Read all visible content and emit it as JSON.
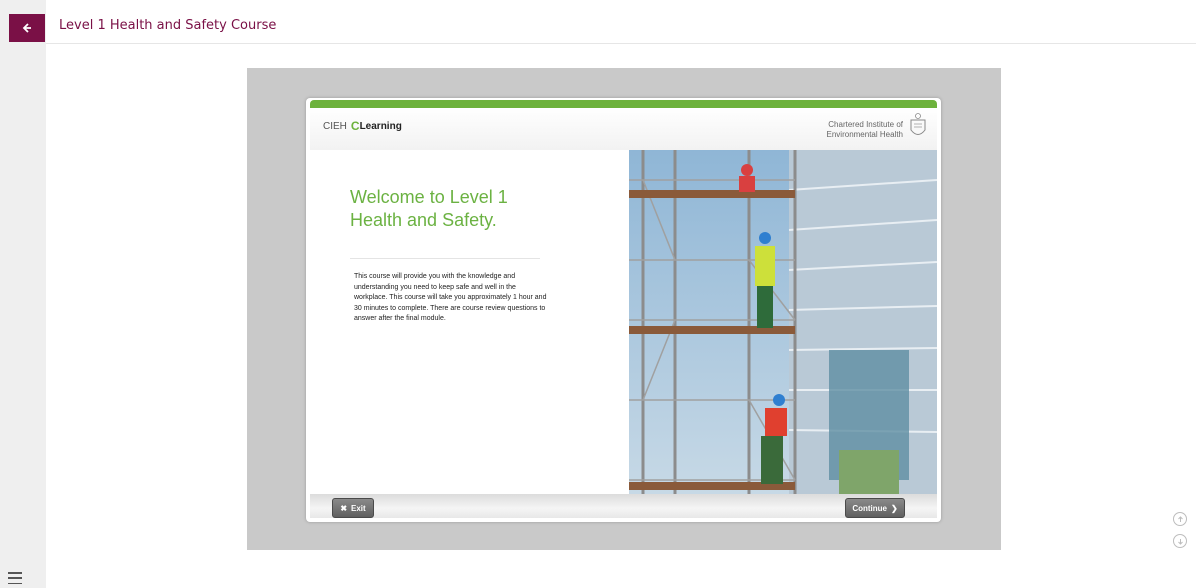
{
  "header": {
    "title": "Level 1 Health and Safety Course"
  },
  "slide": {
    "brand_prefix": "CIEH",
    "brand_c": "C",
    "brand_suffix": "Learning",
    "org_line1": "Chartered Institute of",
    "org_line2": "Environmental Health",
    "heading_line1": "Welcome to Level 1",
    "heading_line2": "Health and Safety.",
    "intro": "This course will provide you with the knowledge and understanding you need to keep safe and well in the workplace.  This course will take you approximately 1 hour and 30 minutes to complete.  There are course review questions to answer after the final module.",
    "exit_label": "Exit",
    "continue_label": "Continue"
  },
  "icons": {
    "back": "arrow-left-icon",
    "menu": "hamburger-icon",
    "scroll_up": "arrow-up-circle-icon",
    "scroll_down": "arrow-down-circle-icon"
  },
  "colors": {
    "brand": "#7a1046",
    "accent_green": "#6db23c",
    "stage_bg": "#c9c9c9"
  }
}
